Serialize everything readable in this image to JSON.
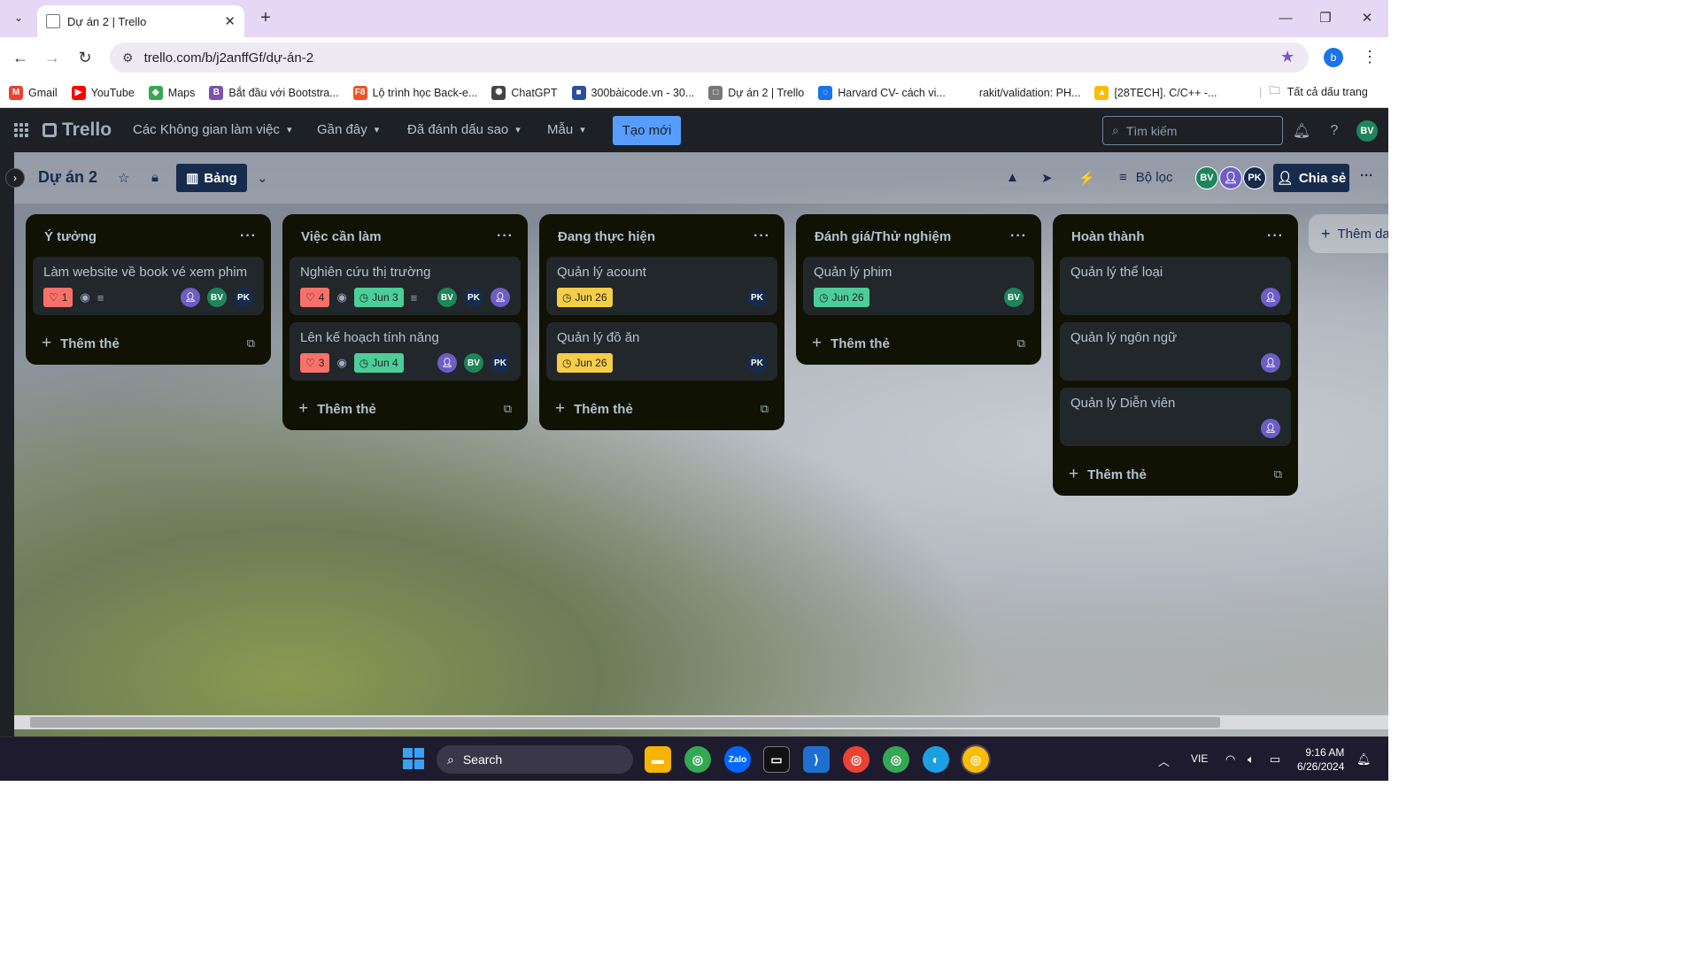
{
  "browser": {
    "tab_title": "Dự án 2 | Trello",
    "url": "trello.com/b/j2anffGf/dự-án-2",
    "profile_initial": "b",
    "bookmarks": [
      {
        "label": "Gmail",
        "color": "#ea4335",
        "glyph": "M"
      },
      {
        "label": "YouTube",
        "color": "#ff0000",
        "glyph": "▶"
      },
      {
        "label": "Maps",
        "color": "#34a853",
        "glyph": "◆"
      },
      {
        "label": "Bắt đầu với Bootstra...",
        "color": "#7952b3",
        "glyph": "B"
      },
      {
        "label": "Lộ trình học Back-e...",
        "color": "#f05123",
        "glyph": "F8"
      },
      {
        "label": "ChatGPT",
        "color": "#444444",
        "glyph": "✺"
      },
      {
        "label": "300bàicode.vn - 30...",
        "color": "#2b4ea2",
        "glyph": "■"
      },
      {
        "label": "Dự án 2 | Trello",
        "color": "#777777",
        "glyph": "□"
      },
      {
        "label": "Harvard CV- cách vi...",
        "color": "#1a73e8",
        "glyph": "◌"
      },
      {
        "label": "rakit/validation: PH...",
        "color": "#ffffff",
        "glyph": ""
      },
      {
        "label": "[28TECH]. C/C++ -...",
        "color": "#fbbc04",
        "glyph": "▲"
      }
    ],
    "all_bookmarks": "Tất cả dấu trang"
  },
  "header": {
    "logo": "Trello",
    "menus": [
      "Các Không gian làm việc",
      "Gần đây",
      "Đã đánh dấu sao",
      "Mẫu"
    ],
    "create": "Tạo mới",
    "search_placeholder": "Tìm kiếm",
    "user_initials": "BV"
  },
  "board": {
    "title": "Dự án 2",
    "view": "Bảng",
    "filter": "Bộ lọc",
    "share": "Chia sẻ",
    "members": [
      "BV",
      "",
      "PK"
    ],
    "add_list": "Thêm danh sách"
  },
  "lists": [
    {
      "title": "Ý tưởng",
      "add": "Thêm thẻ",
      "cards": [
        {
          "title": "Làm website về book vé xem phim",
          "votes": "1",
          "watch": true,
          "desc": true,
          "due": "",
          "due_color": "",
          "members": [
            "user",
            "BV",
            "PK"
          ]
        }
      ]
    },
    {
      "title": "Việc cần làm",
      "add": "Thêm thẻ",
      "cards": [
        {
          "title": "Nghiên cứu thị trường",
          "votes": "4",
          "watch": true,
          "desc": true,
          "due": "Jun 3",
          "due_color": "green",
          "members": [
            "BV",
            "PK",
            "user"
          ]
        },
        {
          "title": "Lên kế hoạch tính năng",
          "votes": "3",
          "watch": true,
          "desc": false,
          "due": "Jun 4",
          "due_color": "green",
          "members": [
            "user",
            "BV",
            "PK"
          ]
        }
      ]
    },
    {
      "title": "Đang thực hiện",
      "add": "Thêm thẻ",
      "cards": [
        {
          "title": "Quản lý acount",
          "votes": "",
          "watch": false,
          "desc": false,
          "due": "Jun 26",
          "due_color": "yellow",
          "members": [
            "PK"
          ]
        },
        {
          "title": "Quản lý đồ ăn",
          "votes": "",
          "watch": false,
          "desc": false,
          "due": "Jun 26",
          "due_color": "yellow",
          "members": [
            "PK"
          ]
        }
      ]
    },
    {
      "title": "Đánh giá/Thử nghiệm",
      "add": "Thêm thẻ",
      "cards": [
        {
          "title": "Quản lý phim",
          "votes": "",
          "watch": false,
          "desc": false,
          "due": "Jun 26",
          "due_color": "green",
          "members": [
            "BV"
          ]
        }
      ]
    },
    {
      "title": "Hoàn thành",
      "add": "Thêm thẻ",
      "cards": [
        {
          "title": "Quản lý thể loại",
          "votes": "",
          "watch": false,
          "desc": false,
          "due": "",
          "due_color": "",
          "members": [
            "user"
          ]
        },
        {
          "title": "Quản lý ngôn ngữ",
          "votes": "",
          "watch": false,
          "desc": false,
          "due": "",
          "due_color": "",
          "members": [
            "user"
          ]
        },
        {
          "title": "Quản lý Diễn viên",
          "votes": "",
          "watch": false,
          "desc": false,
          "due": "",
          "due_color": "",
          "members": [
            "user"
          ]
        }
      ]
    }
  ],
  "taskbar": {
    "search": "Search",
    "lang": "VIE",
    "time": "9:16 AM",
    "date": "6/26/2024"
  }
}
